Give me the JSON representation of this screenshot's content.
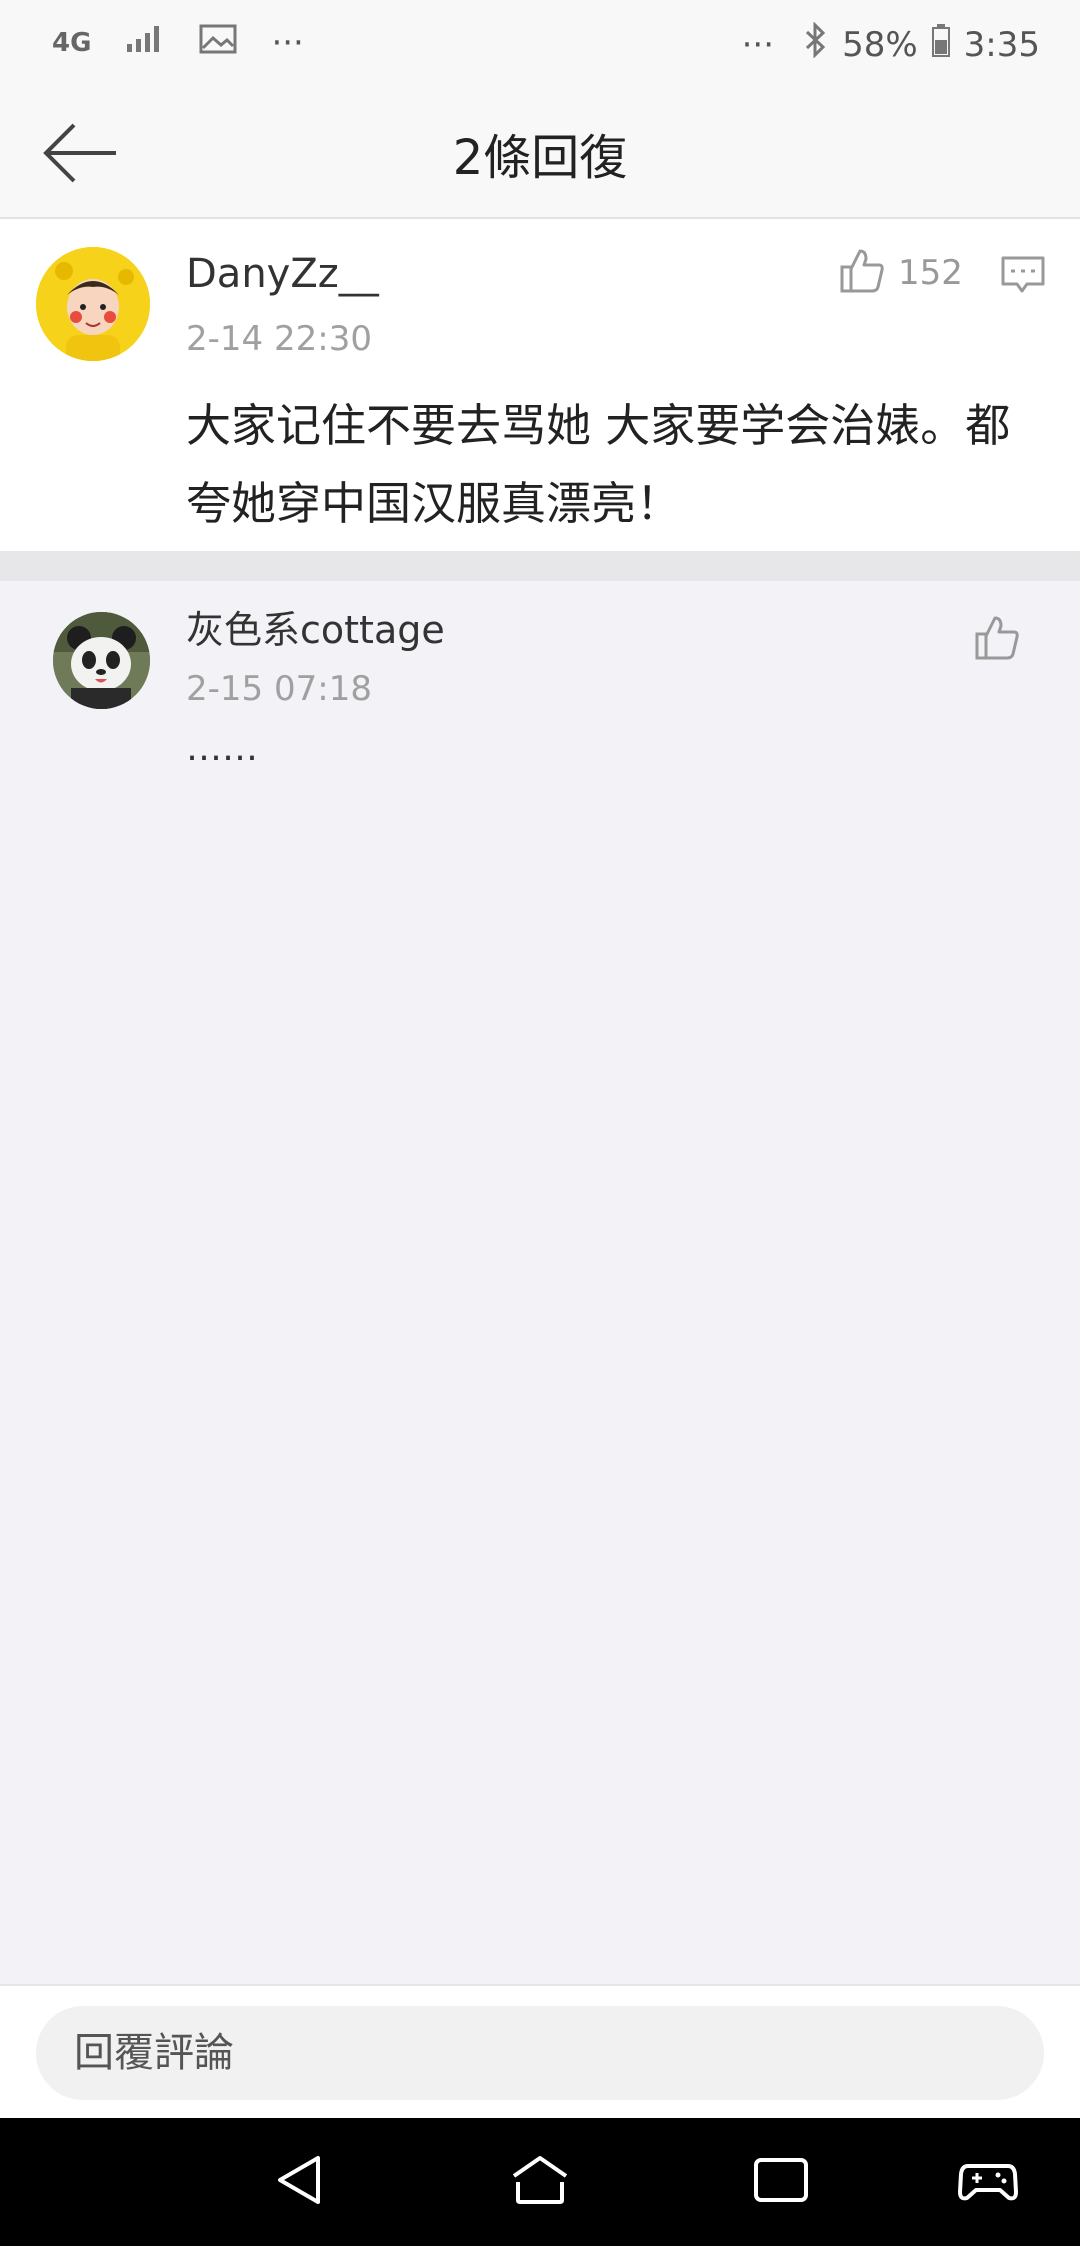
{
  "status_bar": {
    "network": "4G",
    "battery": "58%",
    "time": "3:35",
    "left_more": "···",
    "right_more": "···"
  },
  "header": {
    "title": "2條回復"
  },
  "main_comment": {
    "username": "DanyZz__",
    "timestamp": "2-14 22:30",
    "like_count": "152",
    "content": "大家记住不要去骂她 大家要学会治婊。都夸她穿中国汉服真漂亮！"
  },
  "replies": [
    {
      "username": "灰色系cottage",
      "timestamp": "2-15 07:18",
      "content": "……"
    }
  ],
  "bottom_bar": {
    "placeholder": "回覆評論"
  },
  "colors": {
    "background": "#f3f3f7",
    "card": "#ffffff",
    "muted_text": "#a0a0a0"
  }
}
